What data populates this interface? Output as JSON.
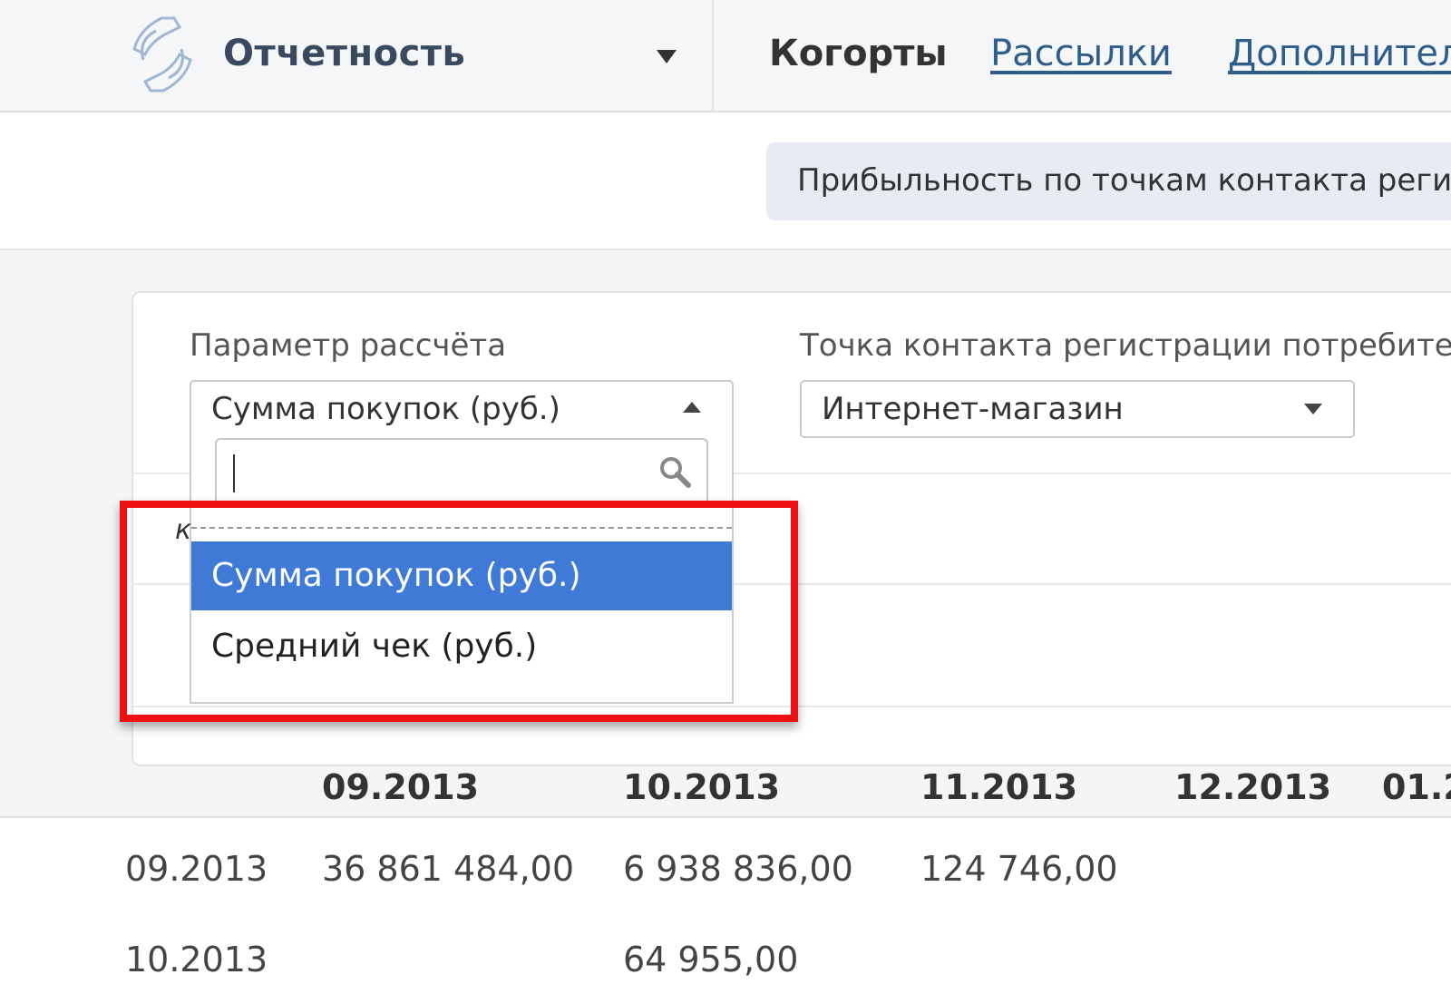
{
  "header": {
    "app_title": "Отчетность",
    "nav": {
      "active": "Когорты",
      "links": [
        "Рассылки",
        "Дополнител"
      ]
    }
  },
  "report": {
    "tab_title": "Прибыльность по точкам контакта регист"
  },
  "filters": {
    "param_label": "Параметр рассчёта",
    "param_selected": "Сумма покупок (руб.)",
    "param_options": [
      "Сумма покупок (руб.)",
      "Средний чек (руб.)"
    ],
    "param_hidden_letter": "к",
    "contact_label": "Точка контакта регистрации потребителя",
    "contact_selected": "Интернет-магазин"
  },
  "table": {
    "columns": [
      "09.2013",
      "10.2013",
      "11.2013",
      "12.2013",
      "01.2"
    ],
    "rows": [
      {
        "label": "09.2013",
        "values": [
          "36 861 484,00",
          "6 938 836,00",
          "124 746,00"
        ]
      },
      {
        "label": "10.2013",
        "values": [
          "",
          "64 955,00",
          ""
        ]
      }
    ]
  },
  "colors": {
    "accent": "#3e7ad6",
    "highlight": "#ee1111",
    "link": "#2f5e8a"
  }
}
